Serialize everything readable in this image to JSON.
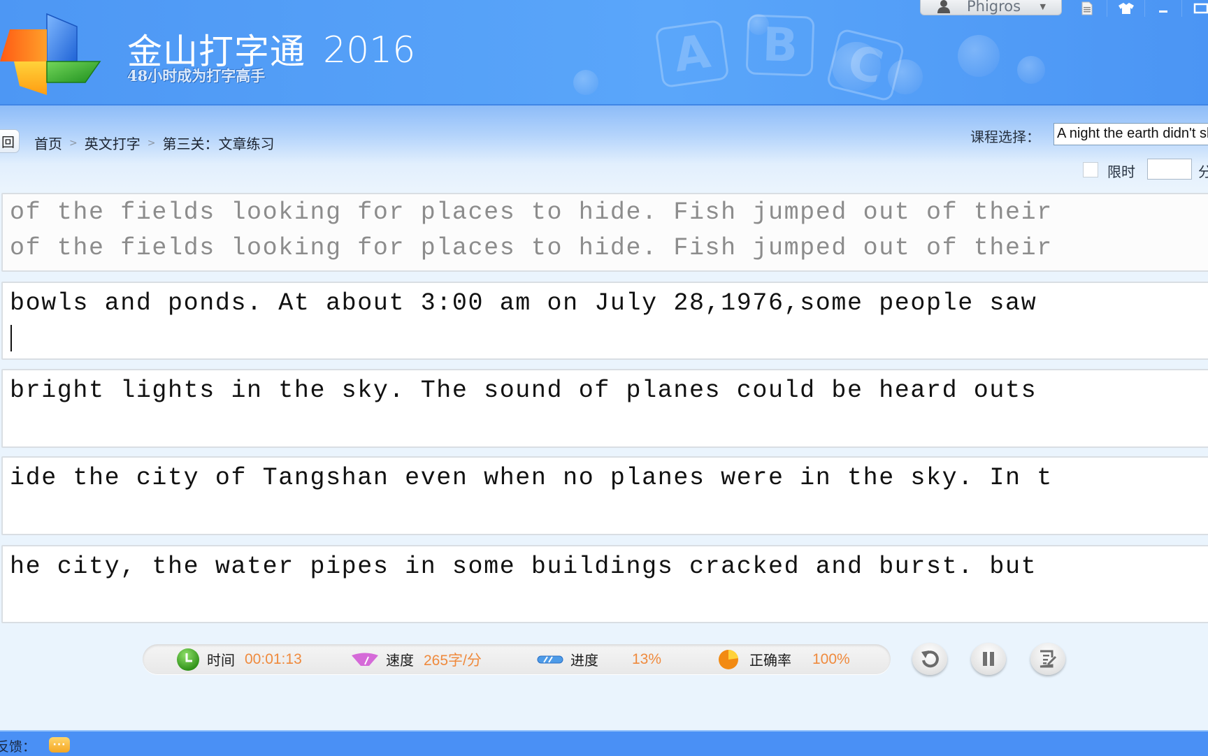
{
  "app": {
    "brand_name": "金山打字通",
    "brand_year": "2016",
    "slogan": "48小时成为打字高手",
    "deco_letters": [
      "A",
      "B",
      "C"
    ]
  },
  "titlebar": {
    "user_name": "Phigros",
    "icons": [
      "user-icon",
      "chevron-down-icon",
      "notes-icon",
      "skin-shirt-icon",
      "minimize-icon",
      "maximize-icon"
    ]
  },
  "nav": {
    "back_label": "回",
    "breadcrumb": [
      "首页",
      "英文打字",
      "第三关：文章练习"
    ],
    "breadcrumb_sep": ">",
    "course_label": "课程选择：",
    "course_value": "A night the earth didn't sleep",
    "time_limit_label": "限时",
    "time_limit_checked": false,
    "time_limit_value": "",
    "time_limit_unit": "分"
  },
  "typing": {
    "completed": {
      "source": "of the fields looking for places to hide. Fish jumped out of their",
      "typed": "of the fields looking for places to hide. Fish jumped out of their"
    },
    "current": {
      "source": "bowls and ponds. At about 3:00 am on July 28,1976,some people saw",
      "typed": ""
    },
    "upcoming": [
      "bright lights in the sky. The sound of planes could be heard outs",
      "ide the city of Tangshan even when no planes were in the sky. In t",
      "he city, the water pipes in some buildings cracked and burst. but"
    ]
  },
  "stats": {
    "time_label": "时间",
    "time_value": "00:01:13",
    "speed_label": "速度",
    "speed_value": "265字/分",
    "progress_label": "进度",
    "progress_value": "13%",
    "accuracy_label": "正确率",
    "accuracy_value": "100%",
    "value_color": "#ef8a3d"
  },
  "controls": {
    "restart": "restart-icon",
    "pause": "pause-icon",
    "report": "report-icon"
  },
  "footer": {
    "feedback_label": "反馈：",
    "feedback_icon_text": "···"
  }
}
